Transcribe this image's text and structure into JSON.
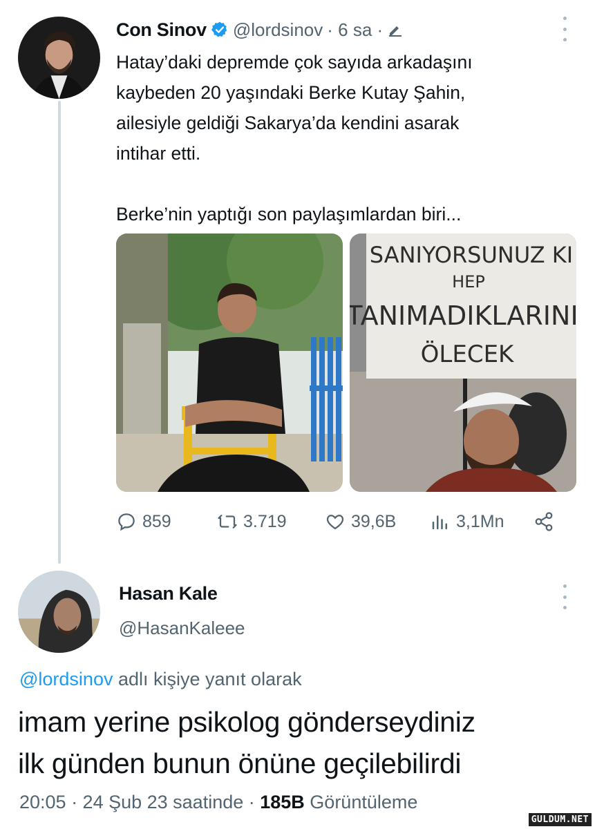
{
  "tweet": {
    "author_name": "Con Sinov",
    "handle": "@lordsinov",
    "time": "· 6 sa ·",
    "verified_color": "#1d9bf0",
    "text": "Hatay’daki depremde çok sayıda arkadaşını\nkaybeden 20 yaşındaki Berke Kutay Şahin,\nailesiyle geldiği Sakarya’da kendini asarak\nintihar etti.\n\nBerke’nin yaptığı son paylaşımlardan biri...",
    "images": [
      {
        "icon": "photo-young-man-on-yellow-chair"
      },
      {
        "icon": "photo-protest-sign",
        "sign_lines": [
          "SANIYORSUNUZ KI",
          "HEP",
          "TANIMADIKLARINIZ",
          "ÖLECEK"
        ]
      }
    ],
    "actions": {
      "replies": "859",
      "retweets": "3.719",
      "likes": "39,6B",
      "views": "3,1Mn"
    }
  },
  "reply": {
    "author_name": "Hasan Kale",
    "handle": "@HasanKaleee",
    "replying_to_mention": "@lordsinov",
    "replying_to_suffix": " adlı kişiye yanıt olarak",
    "text": "imam yerine psikolog gönderseydiniz\nilk günden bunun önüne geçilebilirdi",
    "meta_prefix": "20:05 · 24 Şub 23 saatinde · ",
    "views_count": "185B",
    "views_label": " Görüntüleme"
  },
  "watermark": "GULDUM.NET"
}
